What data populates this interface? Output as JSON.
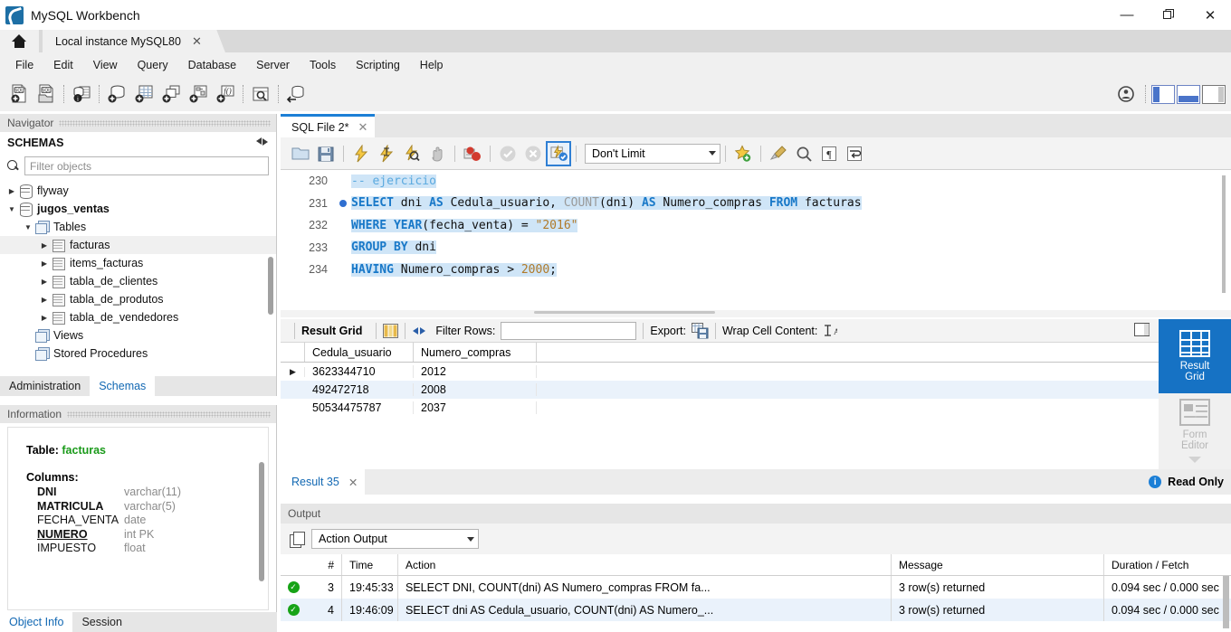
{
  "window": {
    "title": "MySQL Workbench",
    "minimize": "—",
    "restore": "❐",
    "close": "✕"
  },
  "tabstrip": {
    "home_icon": "home-icon",
    "connection_tab": "Local instance MySQL80",
    "close_glyph": "✕"
  },
  "menu": {
    "items": [
      "File",
      "Edit",
      "View",
      "Query",
      "Database",
      "Server",
      "Tools",
      "Scripting",
      "Help"
    ]
  },
  "main_toolbar": {
    "buttons": [
      "new-sql-tab-icon",
      "open-sql-script-icon",
      "connection-info-icon",
      "new-schema-icon",
      "new-table-icon",
      "new-view-icon",
      "new-procedure-icon",
      "new-function-icon",
      "inspect-object-icon",
      "reconnect-dbms-icon"
    ],
    "right_buttons": [
      "profile-icon",
      "toggle-sidebar-icon",
      "toggle-output-icon",
      "toggle-secondary-sidebar-icon"
    ]
  },
  "navigator": {
    "header": "Navigator",
    "section_title": "SCHEMAS",
    "refresh_icon": "refresh-icon",
    "filter_placeholder": "Filter objects",
    "search_icon": "search-icon",
    "tree": [
      {
        "label": "flyway",
        "indent": 0,
        "arrow": "▶",
        "icon": "schema-icon",
        "bold": false,
        "selected": false
      },
      {
        "label": "jugos_ventas",
        "indent": 0,
        "arrow": "▼",
        "icon": "schema-icon",
        "bold": true,
        "selected": false
      },
      {
        "label": "Tables",
        "indent": 1,
        "arrow": "▼",
        "icon": "tables-folder-icon",
        "bold": false,
        "selected": false
      },
      {
        "label": "facturas",
        "indent": 2,
        "arrow": "▶",
        "icon": "table-icon",
        "bold": false,
        "selected": true
      },
      {
        "label": "items_facturas",
        "indent": 2,
        "arrow": "▶",
        "icon": "table-icon",
        "bold": false,
        "selected": false
      },
      {
        "label": "tabla_de_clientes",
        "indent": 2,
        "arrow": "▶",
        "icon": "table-icon",
        "bold": false,
        "selected": false
      },
      {
        "label": "tabla_de_produtos",
        "indent": 2,
        "arrow": "▶",
        "icon": "table-icon",
        "bold": false,
        "selected": false
      },
      {
        "label": "tabla_de_vendedores",
        "indent": 2,
        "arrow": "▶",
        "icon": "table-icon",
        "bold": false,
        "selected": false
      },
      {
        "label": "Views",
        "indent": 1,
        "arrow": "",
        "icon": "views-folder-icon",
        "bold": false,
        "selected": false
      },
      {
        "label": "Stored Procedures",
        "indent": 1,
        "arrow": "",
        "icon": "procedures-folder-icon",
        "bold": false,
        "selected": false
      }
    ],
    "tabs": [
      {
        "label": "Administration",
        "active": false
      },
      {
        "label": "Schemas",
        "active": true
      }
    ]
  },
  "information": {
    "header": "Information",
    "table_label": "Table:",
    "table_name": "facturas",
    "columns_label": "Columns:",
    "columns": [
      {
        "name": "DNI",
        "type": "varchar(11)",
        "style": "bold"
      },
      {
        "name": "MATRICULA",
        "type": "varchar(5)",
        "style": "bold"
      },
      {
        "name": "FECHA_VENTA",
        "type": "date",
        "style": "normal"
      },
      {
        "name": "NUMERO",
        "type": "int PK",
        "style": "underline"
      },
      {
        "name": "IMPUESTO",
        "type": "float",
        "style": "normal"
      }
    ],
    "tabs": [
      {
        "label": "Object Info",
        "active": true
      },
      {
        "label": "Session",
        "active": false
      }
    ]
  },
  "editor": {
    "tab_label": "SQL File 2*",
    "tab_close": "✕",
    "toolbar": {
      "buttons": [
        "open-file-icon",
        "save-file-icon",
        "execute-icon",
        "execute-current-statement-icon",
        "explain-icon",
        "stop-icon",
        "toggle-breakpoint-icon",
        "commit-icon",
        "rollback-icon",
        "toggle-autocommit-icon"
      ],
      "limit_value": "Don't Limit",
      "right_buttons": [
        "save-snippet-icon",
        "beautify-sql-icon",
        "find-icon",
        "toggle-invisible-chars-icon",
        "toggle-word-wrap-icon"
      ]
    },
    "lines": [
      {
        "number": "230",
        "breakpoint": false,
        "highlight": true,
        "tokens": [
          {
            "t": "-- ejercicio",
            "c": "cm"
          }
        ]
      },
      {
        "number": "231",
        "breakpoint": true,
        "highlight": true,
        "tokens": [
          {
            "t": "SELECT",
            "c": "k"
          },
          {
            "t": " dni ",
            "c": "plain"
          },
          {
            "t": "AS",
            "c": "k"
          },
          {
            "t": " Cedula_usuario, ",
            "c": "plain"
          },
          {
            "t": "COUNT",
            "c": "f"
          },
          {
            "t": "(dni) ",
            "c": "plain"
          },
          {
            "t": "AS",
            "c": "k"
          },
          {
            "t": " Numero_compras ",
            "c": "plain"
          },
          {
            "t": "FROM",
            "c": "k"
          },
          {
            "t": " facturas",
            "c": "plain"
          }
        ]
      },
      {
        "number": "232",
        "breakpoint": false,
        "highlight": true,
        "tokens": [
          {
            "t": "WHERE",
            "c": "k"
          },
          {
            "t": " ",
            "c": "plain"
          },
          {
            "t": "YEAR",
            "c": "k"
          },
          {
            "t": "(fecha_venta) = ",
            "c": "plain"
          },
          {
            "t": "\"2016\"",
            "c": "s"
          }
        ]
      },
      {
        "number": "233",
        "breakpoint": false,
        "highlight": true,
        "tokens": [
          {
            "t": "GROUP",
            "c": "k"
          },
          {
            "t": " ",
            "c": "plain"
          },
          {
            "t": "BY",
            "c": "k"
          },
          {
            "t": " dni",
            "c": "plain"
          }
        ]
      },
      {
        "number": "234",
        "breakpoint": false,
        "highlight": true,
        "tokens": [
          {
            "t": "HAVING",
            "c": "k"
          },
          {
            "t": " Numero_compras > ",
            "c": "plain"
          },
          {
            "t": "2000",
            "c": "n"
          },
          {
            "t": ";",
            "c": "plain"
          }
        ]
      }
    ]
  },
  "result_grid": {
    "toolbar": {
      "label": "Result Grid",
      "grid_icon": "grid-view-icon",
      "refresh_icon": "refresh-grid-icon",
      "filter_label": "Filter Rows:",
      "filter_value": "",
      "export_label": "Export:",
      "export_icon": "export-icon",
      "wrap_label": "Wrap Cell Content:",
      "wrap_icon": "wrap-text-icon",
      "fullscreen_icon": "maximize-panel-icon"
    },
    "columns": [
      "Cedula_usuario",
      "Numero_compras"
    ],
    "rows": [
      {
        "marker": "▶",
        "Cedula_usuario": "3623344710",
        "Numero_compras": "2012"
      },
      {
        "marker": "",
        "Cedula_usuario": "492472718",
        "Numero_compras": "2008"
      },
      {
        "marker": "",
        "Cedula_usuario": "50534475787",
        "Numero_compras": "2037"
      }
    ],
    "side_buttons": [
      {
        "label_line1": "Result",
        "label_line2": "Grid",
        "icon": "result-grid-icon",
        "active": true
      },
      {
        "label_line1": "Form",
        "label_line2": "Editor",
        "icon": "form-editor-icon",
        "active": false
      }
    ]
  },
  "result_tab": {
    "label": "Result 35",
    "close": "✕",
    "readonly_label": "Read Only",
    "info_icon": "info-icon",
    "info_glyph": "i"
  },
  "output": {
    "header": "Output",
    "copy_icon": "copy-icon",
    "selector_value": "Action Output",
    "columns": [
      "#",
      "Time",
      "Action",
      "Message",
      "Duration / Fetch"
    ],
    "rows": [
      {
        "status": "success",
        "num": "3",
        "time": "19:45:33",
        "action": "SELECT DNI, COUNT(dni) AS Numero_compras FROM fa...",
        "message": "3 row(s) returned",
        "duration": "0.094 sec / 0.000 sec"
      },
      {
        "status": "success",
        "num": "4",
        "time": "19:46:09",
        "action": "SELECT dni AS Cedula_usuario, COUNT(dni) AS Numero_...",
        "message": "3 row(s) returned",
        "duration": "0.094 sec / 0.000 sec"
      }
    ]
  },
  "colors": {
    "accent": "#1672c4",
    "keyword": "#1878c8",
    "string": "#b07a2a",
    "comment": "#5aa9df",
    "highlight": "#cfe5f7",
    "success": "#17a317"
  }
}
